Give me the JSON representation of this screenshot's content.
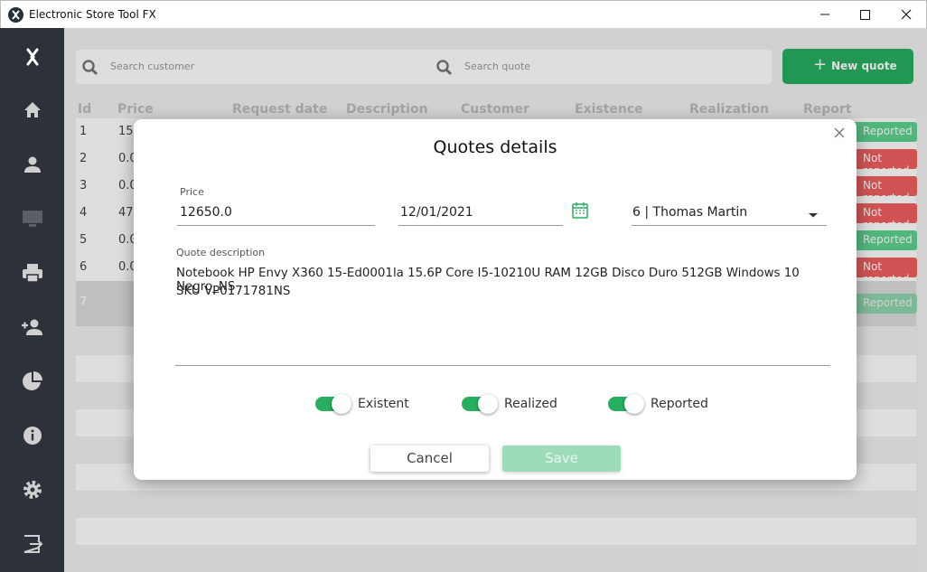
{
  "window": {
    "title": "Electronic Store Tool FX"
  },
  "sidebar": {
    "items": [
      "logo-icon",
      "home-icon",
      "person-icon",
      "monitor-icon",
      "printer-icon",
      "person-add-icon",
      "pie-chart-icon",
      "info-icon",
      "gear-icon",
      "exit-icon"
    ]
  },
  "search": {
    "customer_placeholder": "Search customer",
    "quote_placeholder": "Search quote"
  },
  "toolbar": {
    "new_quote_label": "New quote",
    "new_quote_plus": "+"
  },
  "table": {
    "columns": [
      "Id",
      "Price",
      "Request date",
      "Description",
      "Customer",
      "Existence",
      "Realization",
      "Report"
    ],
    "rows": [
      {
        "id": "1",
        "price": "15",
        "badge": "Reported",
        "badge_color": "#5dd28f"
      },
      {
        "id": "2",
        "price": "0.0",
        "badge": "Not reported",
        "badge_color": "#ef5f5f"
      },
      {
        "id": "3",
        "price": "0.0",
        "badge": "Not reported",
        "badge_color": "#ef5f5f"
      },
      {
        "id": "4",
        "price": "47",
        "badge": "Not reported",
        "badge_color": "#ef5f5f"
      },
      {
        "id": "5",
        "price": "0.0",
        "badge": "Reported",
        "badge_color": "#5dd28f"
      },
      {
        "id": "6",
        "price": "0.0",
        "badge": "Not reported",
        "badge_color": "#ef5f5f"
      },
      {
        "id": "7",
        "price": "",
        "badge": "Reported",
        "badge_color": "#5dd28f"
      }
    ]
  },
  "dialog": {
    "title": "Quotes details",
    "price_label": "Price",
    "price_value": "12650.0",
    "date_value": "12/01/2021",
    "customer_value": "6 | Thomas Martin",
    "description_label": "Quote description",
    "description_line1": "Notebook HP Envy X360 15-Ed0001la 15.6P Core I5-10210U RAM 12GB Disco Duro 512GB Windows 10 Negro_NS",
    "description_line2": "SKU VP0171781NS",
    "toggles": [
      {
        "label": "Existent",
        "on": true
      },
      {
        "label": "Realized",
        "on": true
      },
      {
        "label": "Reported",
        "on": true
      }
    ],
    "cancel_label": "Cancel",
    "save_label": "Save"
  },
  "colors": {
    "accent": "#27ae60",
    "sidebar": "#2d3139",
    "save_disabled": "#9ddcb9"
  }
}
